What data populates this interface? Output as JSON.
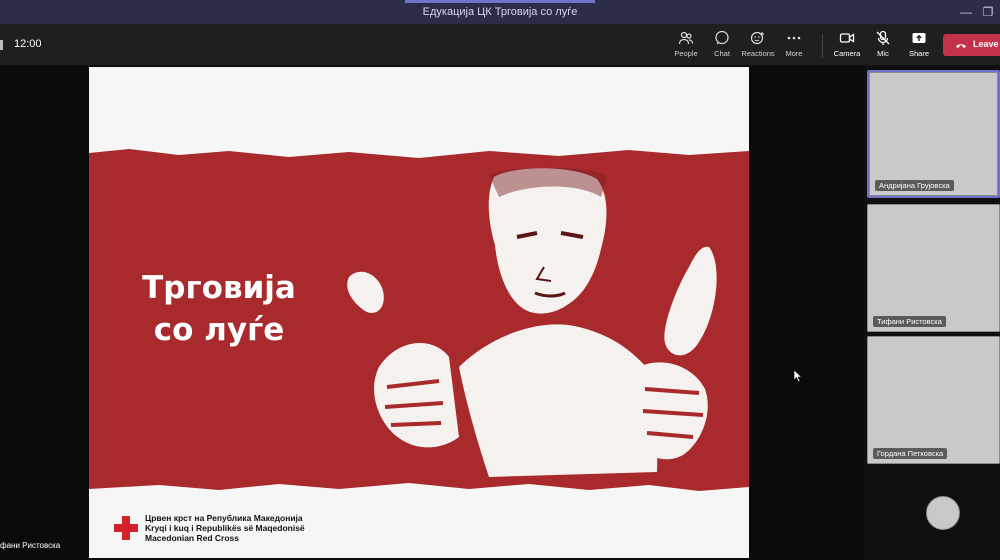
{
  "window": {
    "title": "Едукација ЦК Трговија со луѓе"
  },
  "toolbar": {
    "timer": "12:00",
    "buttons": {
      "people": "People",
      "chat": "Chat",
      "reactions": "Reactions",
      "more": "More",
      "camera": "Camera",
      "mic": "Mic",
      "share": "Share",
      "leave": "Leave"
    }
  },
  "slide": {
    "title_line1": "Трговија",
    "title_line2": "со луѓе",
    "logo_line1": "Црвен крст на Република Македонија",
    "logo_line2": "Kryqi i kuq i  Republikës së Maqedonisë",
    "logo_line3": "Macedonian Red Cross",
    "colors": {
      "band": "#a92a2c",
      "cross": "#d3202a"
    }
  },
  "stage": {
    "presenter_name": "фани Ристовска"
  },
  "participants": [
    {
      "name": "Андријана Грујовска"
    },
    {
      "name": "Тифани Ристовска"
    },
    {
      "name": "Гордана Петковска"
    }
  ],
  "colors": {
    "titlebar": "#2b2c4a",
    "toolbar": "#1f1f1f",
    "leave": "#c4314b",
    "active_tile_border": "#6f72c9"
  }
}
